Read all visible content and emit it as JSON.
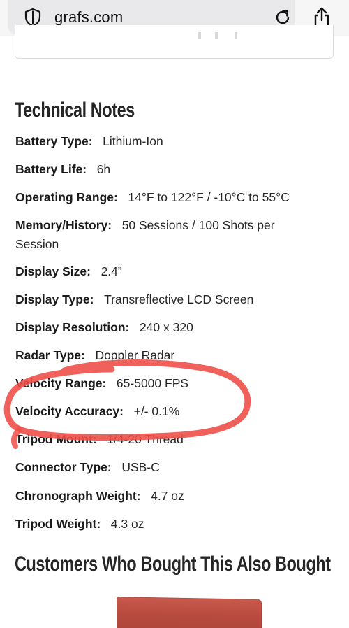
{
  "browser": {
    "url": "grafs.com"
  },
  "technical_notes": {
    "title": "Technical Notes",
    "specs": [
      {
        "label": "Battery Type:",
        "value": "Lithium-Ion"
      },
      {
        "label": "Battery Life:",
        "value": "6h"
      },
      {
        "label": "Operating Range:",
        "value": "14°F to 122°F / -10°C to 55°C"
      },
      {
        "label": "Memory/History:",
        "value": "50 Sessions / 100 Shots per Session"
      },
      {
        "label": "Display Size:",
        "value": "2.4”"
      },
      {
        "label": "Display Type:",
        "value": "Transreflective LCD Screen"
      },
      {
        "label": "Display Resolution:",
        "value": "240 x 320"
      },
      {
        "label": "Radar Type:",
        "value": "Doppler Radar"
      },
      {
        "label": "Velocity Range:",
        "value": "65-5000 FPS"
      },
      {
        "label": "Velocity Accuracy:",
        "value": "+/- 0.1%"
      },
      {
        "label": "Tripod Mount:",
        "value": "1/4-20 Thread"
      },
      {
        "label": "Connector Type:",
        "value": "USB-C"
      },
      {
        "label": "Chronograph Weight:",
        "value": "4.7 oz"
      },
      {
        "label": "Tripod Weight:",
        "value": "4.3 oz"
      }
    ]
  },
  "customers": {
    "title": "Customers Who Bought This Also Bought"
  },
  "colors": {
    "annotation": "#f0504a",
    "product": "#b84a3e"
  }
}
